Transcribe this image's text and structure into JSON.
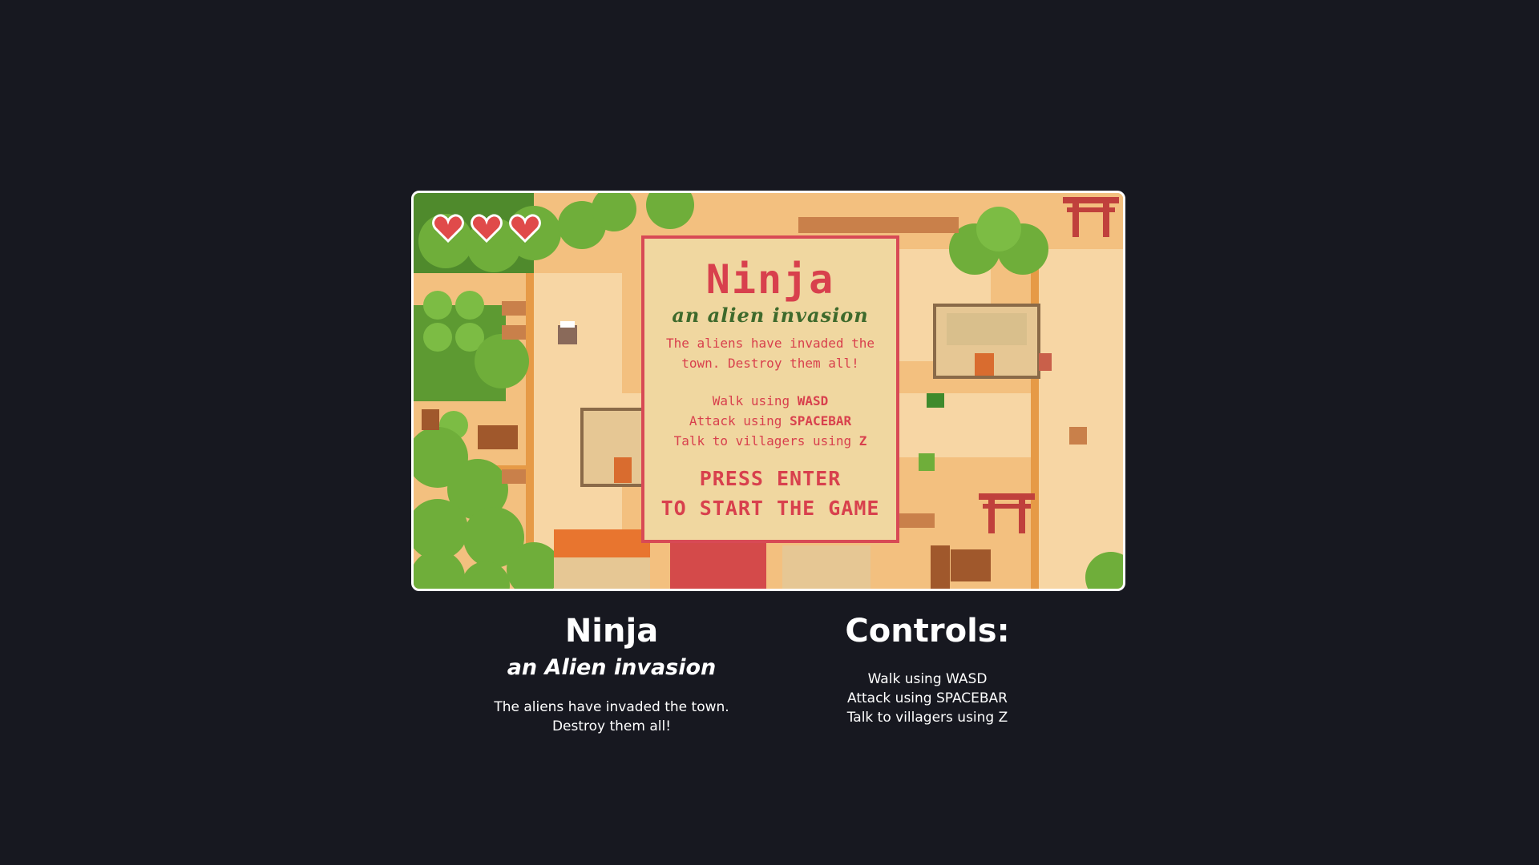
{
  "game": {
    "hud": {
      "hearts_full": 3
    },
    "title_card": {
      "title": "Ninja",
      "subtitle": "an alien invasion",
      "intro_line1": "The aliens have invaded the",
      "intro_line2": "town. Destroy them all!",
      "controls": [
        {
          "prefix": "Walk using ",
          "key": "WASD"
        },
        {
          "prefix": "Attack using ",
          "key": "SPACEBAR"
        },
        {
          "prefix": "Talk to villagers using ",
          "key": "Z"
        }
      ],
      "cta_line1": "PRESS ENTER",
      "cta_line2": "TO START THE GAME"
    }
  },
  "info": {
    "title": "Ninja",
    "subtitle": "an Alien invasion",
    "desc_line1": "The aliens have invaded the town.",
    "desc_line2": "Destroy them all!"
  },
  "controls_info": {
    "title": "Controls:",
    "items": [
      "Walk using WASD",
      "Attack using SPACEBAR",
      "Talk to villagers using Z"
    ]
  },
  "colors": {
    "page_bg": "#171820",
    "ground": "#f3c07f",
    "path": "#f7d6a4",
    "tree": "#6fae3a",
    "accent_red": "#d8404d",
    "card_bg": "#f0d7a0",
    "subtitle_green": "#3e6a2c"
  }
}
